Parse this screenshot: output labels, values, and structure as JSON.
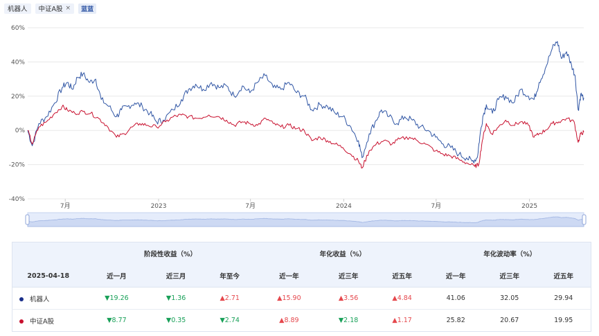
{
  "tags": [
    {
      "label": "机器人",
      "removable": false
    },
    {
      "label": "中证A股",
      "removable": true
    }
  ],
  "compare_icon": "蓝蓝",
  "remove_icon": "×",
  "chart_data": {
    "type": "line",
    "y_ticks": [
      "60%",
      "40%",
      "20%",
      "0%",
      "-20%",
      "-40%"
    ],
    "ylim": [
      -40,
      60
    ],
    "x_ticks": [
      "7月",
      "2023",
      "7月",
      "2024",
      "7月",
      "2025"
    ],
    "x_range": [
      "2022-04-18",
      "2025-04-18"
    ],
    "grid": true,
    "series": [
      {
        "name": "机器人",
        "color": "#2f55a4",
        "points": [
          [
            "2022-04-18",
            0
          ],
          [
            "2022-04-27",
            -9
          ],
          [
            "2022-05-10",
            4
          ],
          [
            "2022-05-25",
            8
          ],
          [
            "2022-06-10",
            16
          ],
          [
            "2022-06-25",
            25
          ],
          [
            "2022-07-05",
            28
          ],
          [
            "2022-07-15",
            24
          ],
          [
            "2022-07-25",
            31
          ],
          [
            "2022-08-05",
            33
          ],
          [
            "2022-08-18",
            28
          ],
          [
            "2022-08-30",
            30
          ],
          [
            "2022-09-10",
            18
          ],
          [
            "2022-09-25",
            14
          ],
          [
            "2022-10-10",
            8
          ],
          [
            "2022-10-20",
            12
          ],
          [
            "2022-11-01",
            14
          ],
          [
            "2022-11-15",
            16
          ],
          [
            "2022-11-30",
            14
          ],
          [
            "2022-12-15",
            10
          ],
          [
            "2022-12-28",
            5
          ],
          [
            "2023-01-10",
            6
          ],
          [
            "2023-01-30",
            12
          ],
          [
            "2023-02-15",
            18
          ],
          [
            "2023-03-01",
            24
          ],
          [
            "2023-03-15",
            27
          ],
          [
            "2023-03-30",
            24
          ],
          [
            "2023-04-15",
            28
          ],
          [
            "2023-04-30",
            25
          ],
          [
            "2023-05-15",
            26
          ],
          [
            "2023-05-30",
            20
          ],
          [
            "2023-06-15",
            26
          ],
          [
            "2023-06-30",
            22
          ],
          [
            "2023-07-15",
            28
          ],
          [
            "2023-07-30",
            32
          ],
          [
            "2023-08-15",
            25
          ],
          [
            "2023-08-30",
            24
          ],
          [
            "2023-09-15",
            28
          ],
          [
            "2023-09-30",
            22
          ],
          [
            "2023-10-15",
            20
          ],
          [
            "2023-10-30",
            12
          ],
          [
            "2023-11-15",
            15
          ],
          [
            "2023-11-30",
            14
          ],
          [
            "2023-12-15",
            10
          ],
          [
            "2023-12-30",
            8
          ],
          [
            "2024-01-15",
            2
          ],
          [
            "2024-01-30",
            -6
          ],
          [
            "2024-02-06",
            -16
          ],
          [
            "2024-02-20",
            -2
          ],
          [
            "2024-03-05",
            6
          ],
          [
            "2024-03-15",
            12
          ],
          [
            "2024-03-30",
            8
          ],
          [
            "2024-04-15",
            4
          ],
          [
            "2024-04-30",
            8
          ],
          [
            "2024-05-15",
            6
          ],
          [
            "2024-05-30",
            2
          ],
          [
            "2024-06-15",
            0
          ],
          [
            "2024-06-30",
            -4
          ],
          [
            "2024-07-15",
            -8
          ],
          [
            "2024-07-30",
            -10
          ],
          [
            "2024-08-15",
            -14
          ],
          [
            "2024-08-30",
            -16
          ],
          [
            "2024-09-10",
            -18
          ],
          [
            "2024-09-20",
            -16
          ],
          [
            "2024-09-25",
            -4
          ],
          [
            "2024-10-01",
            8
          ],
          [
            "2024-10-08",
            15
          ],
          [
            "2024-10-20",
            10
          ],
          [
            "2024-11-01",
            18
          ],
          [
            "2024-11-15",
            20
          ],
          [
            "2024-11-30",
            16
          ],
          [
            "2024-12-15",
            24
          ],
          [
            "2024-12-30",
            20
          ],
          [
            "2025-01-10",
            18
          ],
          [
            "2025-01-20",
            28
          ],
          [
            "2025-02-01",
            36
          ],
          [
            "2025-02-15",
            48
          ],
          [
            "2025-02-25",
            52
          ],
          [
            "2025-03-05",
            42
          ],
          [
            "2025-03-15",
            46
          ],
          [
            "2025-03-25",
            38
          ],
          [
            "2025-04-01",
            32
          ],
          [
            "2025-04-07",
            12
          ],
          [
            "2025-04-12",
            21
          ],
          [
            "2025-04-18",
            19
          ]
        ]
      },
      {
        "name": "中证A股",
        "color": "#c8102e",
        "points": [
          [
            "2022-04-18",
            0
          ],
          [
            "2022-04-27",
            -8
          ],
          [
            "2022-05-10",
            2
          ],
          [
            "2022-05-25",
            5
          ],
          [
            "2022-06-10",
            10
          ],
          [
            "2022-06-25",
            14
          ],
          [
            "2022-07-05",
            12
          ],
          [
            "2022-07-20",
            10
          ],
          [
            "2022-08-05",
            11
          ],
          [
            "2022-08-20",
            10
          ],
          [
            "2022-09-05",
            7
          ],
          [
            "2022-09-20",
            3
          ],
          [
            "2022-10-10",
            -4
          ],
          [
            "2022-10-25",
            -2
          ],
          [
            "2022-11-10",
            2
          ],
          [
            "2022-11-25",
            4
          ],
          [
            "2022-12-10",
            3
          ],
          [
            "2022-12-28",
            2
          ],
          [
            "2023-01-15",
            5
          ],
          [
            "2023-01-30",
            8
          ],
          [
            "2023-02-15",
            9
          ],
          [
            "2023-03-01",
            8
          ],
          [
            "2023-03-20",
            7
          ],
          [
            "2023-04-10",
            9
          ],
          [
            "2023-04-30",
            8
          ],
          [
            "2023-05-15",
            6
          ],
          [
            "2023-05-30",
            3
          ],
          [
            "2023-06-15",
            5
          ],
          [
            "2023-06-30",
            4
          ],
          [
            "2023-07-15",
            3
          ],
          [
            "2023-07-31",
            7
          ],
          [
            "2023-08-15",
            4
          ],
          [
            "2023-08-30",
            2
          ],
          [
            "2023-09-15",
            3
          ],
          [
            "2023-09-30",
            1
          ],
          [
            "2023-10-15",
            0
          ],
          [
            "2023-10-30",
            -6
          ],
          [
            "2023-11-15",
            -4
          ],
          [
            "2023-11-30",
            -6
          ],
          [
            "2023-12-15",
            -8
          ],
          [
            "2023-12-30",
            -10
          ],
          [
            "2024-01-15",
            -14
          ],
          [
            "2024-01-30",
            -18
          ],
          [
            "2024-02-06",
            -22
          ],
          [
            "2024-02-20",
            -12
          ],
          [
            "2024-03-05",
            -8
          ],
          [
            "2024-03-20",
            -6
          ],
          [
            "2024-04-05",
            -8
          ],
          [
            "2024-04-20",
            -5
          ],
          [
            "2024-05-10",
            -4
          ],
          [
            "2024-05-25",
            -6
          ],
          [
            "2024-06-10",
            -8
          ],
          [
            "2024-06-30",
            -12
          ],
          [
            "2024-07-15",
            -14
          ],
          [
            "2024-07-30",
            -15
          ],
          [
            "2024-08-15",
            -17
          ],
          [
            "2024-08-30",
            -19
          ],
          [
            "2024-09-15",
            -21
          ],
          [
            "2024-09-23",
            -20
          ],
          [
            "2024-09-30",
            -6
          ],
          [
            "2024-10-08",
            4
          ],
          [
            "2024-10-18",
            -2
          ],
          [
            "2024-11-01",
            2
          ],
          [
            "2024-11-15",
            6
          ],
          [
            "2024-11-30",
            3
          ],
          [
            "2024-12-15",
            5
          ],
          [
            "2024-12-30",
            3
          ],
          [
            "2025-01-10",
            -4
          ],
          [
            "2025-01-20",
            -2
          ],
          [
            "2025-02-01",
            0
          ],
          [
            "2025-02-15",
            4
          ],
          [
            "2025-02-28",
            5
          ],
          [
            "2025-03-15",
            7
          ],
          [
            "2025-03-30",
            5
          ],
          [
            "2025-04-07",
            -7
          ],
          [
            "2025-04-12",
            -2
          ],
          [
            "2025-04-18",
            -1
          ]
        ]
      }
    ]
  },
  "table": {
    "date": "2025-04-18",
    "groups": [
      "阶段性收益（%）",
      "年化收益（%）",
      "年化波动率（%）"
    ],
    "columns": [
      "近一月",
      "近三月",
      "年至今",
      "近一年",
      "近三年",
      "近五年",
      "近一年",
      "近三年",
      "近五年"
    ],
    "rows": [
      {
        "name": "机器人",
        "color": "#1a2f8a",
        "cells": [
          {
            "text": "19.26",
            "dir": "down"
          },
          {
            "text": "1.36",
            "dir": "down"
          },
          {
            "text": "2.71",
            "dir": "up"
          },
          {
            "text": "15.90",
            "dir": "up"
          },
          {
            "text": "3.56",
            "dir": "up"
          },
          {
            "text": "4.84",
            "dir": "up"
          },
          {
            "text": "41.06",
            "dir": ""
          },
          {
            "text": "32.05",
            "dir": ""
          },
          {
            "text": "29.94",
            "dir": ""
          }
        ]
      },
      {
        "name": "中证A股",
        "color": "#c8102e",
        "cells": [
          {
            "text": "8.77",
            "dir": "down"
          },
          {
            "text": "0.35",
            "dir": "down"
          },
          {
            "text": "2.74",
            "dir": "down"
          },
          {
            "text": "8.89",
            "dir": "up"
          },
          {
            "text": "2.18",
            "dir": "down"
          },
          {
            "text": "1.17",
            "dir": "up"
          },
          {
            "text": "25.82",
            "dir": ""
          },
          {
            "text": "20.67",
            "dir": ""
          },
          {
            "text": "19.95",
            "dir": ""
          }
        ]
      }
    ]
  }
}
